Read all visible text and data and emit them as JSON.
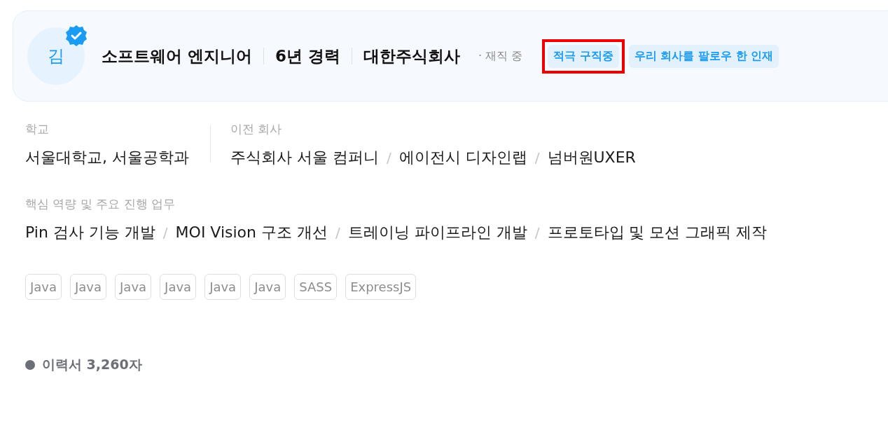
{
  "profile": {
    "avatar_initial": "김",
    "verified": true,
    "headline": [
      "소프트웨어 엔지니어",
      "6년 경력",
      "대한주식회사"
    ],
    "status": "· 재직 중",
    "badges": [
      {
        "label": "적극 구직중",
        "highlighted": true
      },
      {
        "label": "우리 회사를 팔로우 한 인재",
        "highlighted": false
      }
    ]
  },
  "education": {
    "label": "학교",
    "value": "서울대학교, 서울공학과"
  },
  "list_separator": "/",
  "previous_companies": {
    "label": "이전 회사",
    "items": [
      "주식회사 서울 컴퍼니",
      "에이전시 디자인랩",
      "넘버원UXER"
    ]
  },
  "core_tasks": {
    "label": "핵심 역량 및 주요 진행 업무",
    "items": [
      "Pin 검사 기능 개발",
      "MOI Vision 구조 개선",
      "트레이닝 파이프라인 개발",
      "프로토타입 및 모션 그래픽 제작"
    ]
  },
  "skills": [
    "Java",
    "Java",
    "Java",
    "Java",
    "Java",
    "Java",
    "SASS",
    "ExpressJS"
  ],
  "resume_length": "이력서 3,260자"
}
